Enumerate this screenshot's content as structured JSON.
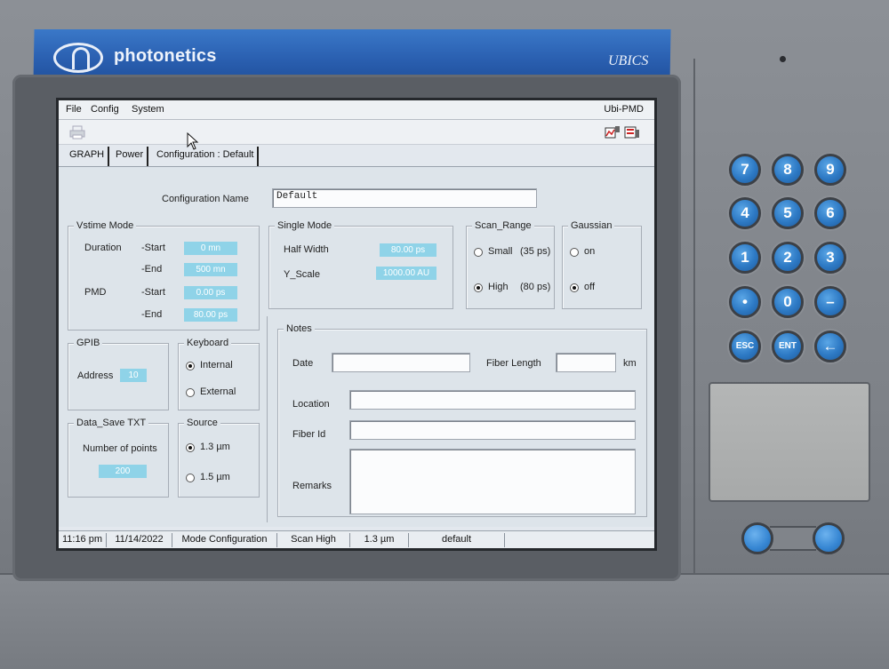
{
  "brand": {
    "name": "photonetics",
    "model": "UBICS"
  },
  "menu": {
    "file": "File",
    "config": "Config",
    "system": "System",
    "app_name": "Ubi-PMD"
  },
  "tabs": {
    "graph": "GRAPH",
    "power": "Power",
    "configuration": "Configuration : Default"
  },
  "config_name": {
    "label": "Configuration Name",
    "value": "Default"
  },
  "vstime": {
    "title": "Vstime Mode",
    "duration": "Duration",
    "pmd": "PMD",
    "start": "-Start",
    "end": "-End",
    "duration_start": "0 mn",
    "duration_end": "500 mn",
    "pmd_start": "0.00 ps",
    "pmd_end": "80.00 ps"
  },
  "single_mode": {
    "title": "Single Mode",
    "half_width_label": "Half Width",
    "half_width": "80.00 ps",
    "y_scale_label": "Y_Scale",
    "y_scale": "1000.00 AU"
  },
  "scan_range": {
    "title": "Scan_Range",
    "small": "Small",
    "small_val": "(35 ps)",
    "high": "High",
    "high_val": "(80 ps)"
  },
  "gaussian": {
    "title": "Gaussian",
    "on": "on",
    "off": "off"
  },
  "gpib": {
    "title": "GPIB",
    "address_label": "Address",
    "address": "10"
  },
  "keyboard": {
    "title": "Keyboard",
    "internal": "Internal",
    "external": "External"
  },
  "data_save": {
    "title": "Data_Save  TXT",
    "points_label": "Number of points",
    "points": "200"
  },
  "source": {
    "title": "Source",
    "opt1": "1.3 µm",
    "opt2": "1.5 µm"
  },
  "notes": {
    "title": "Notes",
    "date": "Date",
    "fiber_length": "Fiber Length",
    "km": "km",
    "location": "Location",
    "fiber_id": "Fiber Id",
    "remarks": "Remarks"
  },
  "status": {
    "time": "11:16 pm",
    "date": "11/14/2022",
    "mode": "Mode Configuration",
    "scan": "Scan High",
    "source": "1.3 µm",
    "config": "default"
  },
  "keypad": {
    "k7": "7",
    "k8": "8",
    "k9": "9",
    "k4": "4",
    "k5": "5",
    "k6": "6",
    "k1": "1",
    "k2": "2",
    "k3": "3",
    "kdot": "•",
    "k0": "0",
    "kminus": "–",
    "esc": "ESC",
    "ent": "ENT",
    "back": "←"
  }
}
